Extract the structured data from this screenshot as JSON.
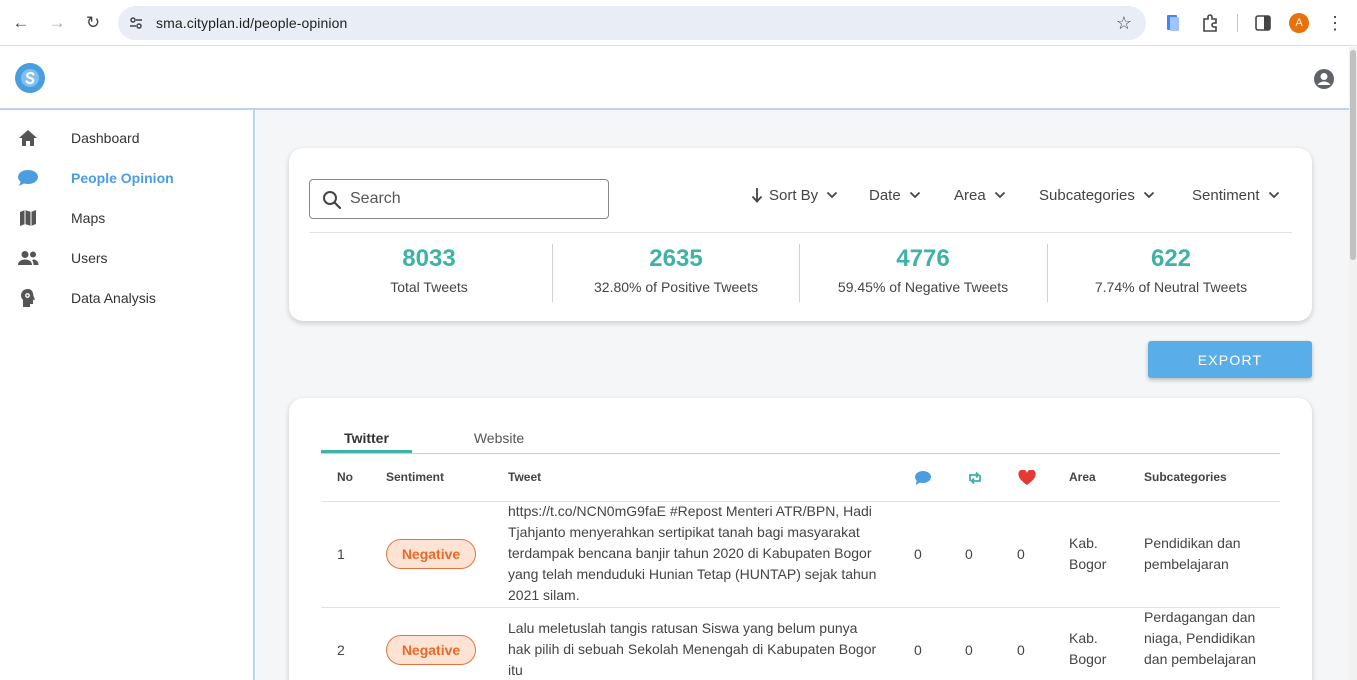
{
  "browser": {
    "url": "sma.cityplan.id/people-opinion",
    "profile_initial": "A"
  },
  "sidebar": {
    "items": [
      {
        "label": "Dashboard",
        "icon": "home-icon"
      },
      {
        "label": "People Opinion",
        "icon": "chat-bubble-icon",
        "active": true
      },
      {
        "label": "Maps",
        "icon": "map-icon"
      },
      {
        "label": "Users",
        "icon": "users-icon"
      },
      {
        "label": "Data Analysis",
        "icon": "head-gear-icon"
      }
    ]
  },
  "filters": {
    "search_placeholder": "Search",
    "sort_by": "Sort By",
    "date": "Date",
    "area": "Area",
    "subcategories": "Subcategories",
    "sentiment": "Sentiment"
  },
  "stats": [
    {
      "value": "8033",
      "caption": "Total Tweets"
    },
    {
      "value": "2635",
      "caption": "32.80% of Positive Tweets"
    },
    {
      "value": "4776",
      "caption": "59.45% of Negative Tweets"
    },
    {
      "value": "622",
      "caption": "7.74% of Neutral Tweets"
    }
  ],
  "export_label": "EXPORT",
  "tabs": [
    "Twitter",
    "Website"
  ],
  "table": {
    "headers": {
      "no": "No",
      "sentiment": "Sentiment",
      "tweet": "Tweet",
      "area": "Area",
      "subcategories": "Subcategories"
    },
    "rows": [
      {
        "no": "1",
        "sentiment": "Negative",
        "tweet": "https://t.co/NCN0mG9faE #Repost Menteri ATR/BPN, Hadi Tjahjanto menyerahkan sertipikat tanah bagi masyarakat terdampak bencana banjir tahun 2020 di Kabupaten Bogor yang telah menduduki Hunian Tetap (HUNTAP) sejak tahun 2021 silam.",
        "replies": "0",
        "retweets": "0",
        "likes": "0",
        "area": "Kab. Bogor",
        "subcategories": "Pendidikan dan pembelajaran"
      },
      {
        "no": "2",
        "sentiment": "Negative",
        "tweet": "Lalu meletuslah tangis ratusan Siswa yang belum punya hak pilih di sebuah Sekolah Menengah di Kabupaten Bogor itu",
        "replies": "0",
        "retweets": "0",
        "likes": "0",
        "area": "Kab. Bogor",
        "subcategories": "Perdagangan dan niaga, Pendidikan dan pembelajaran"
      }
    ]
  },
  "colors": {
    "accent": "#3db3a6",
    "primary": "#4a9ee0",
    "negative": "#e8692a",
    "heart": "#e53935"
  }
}
